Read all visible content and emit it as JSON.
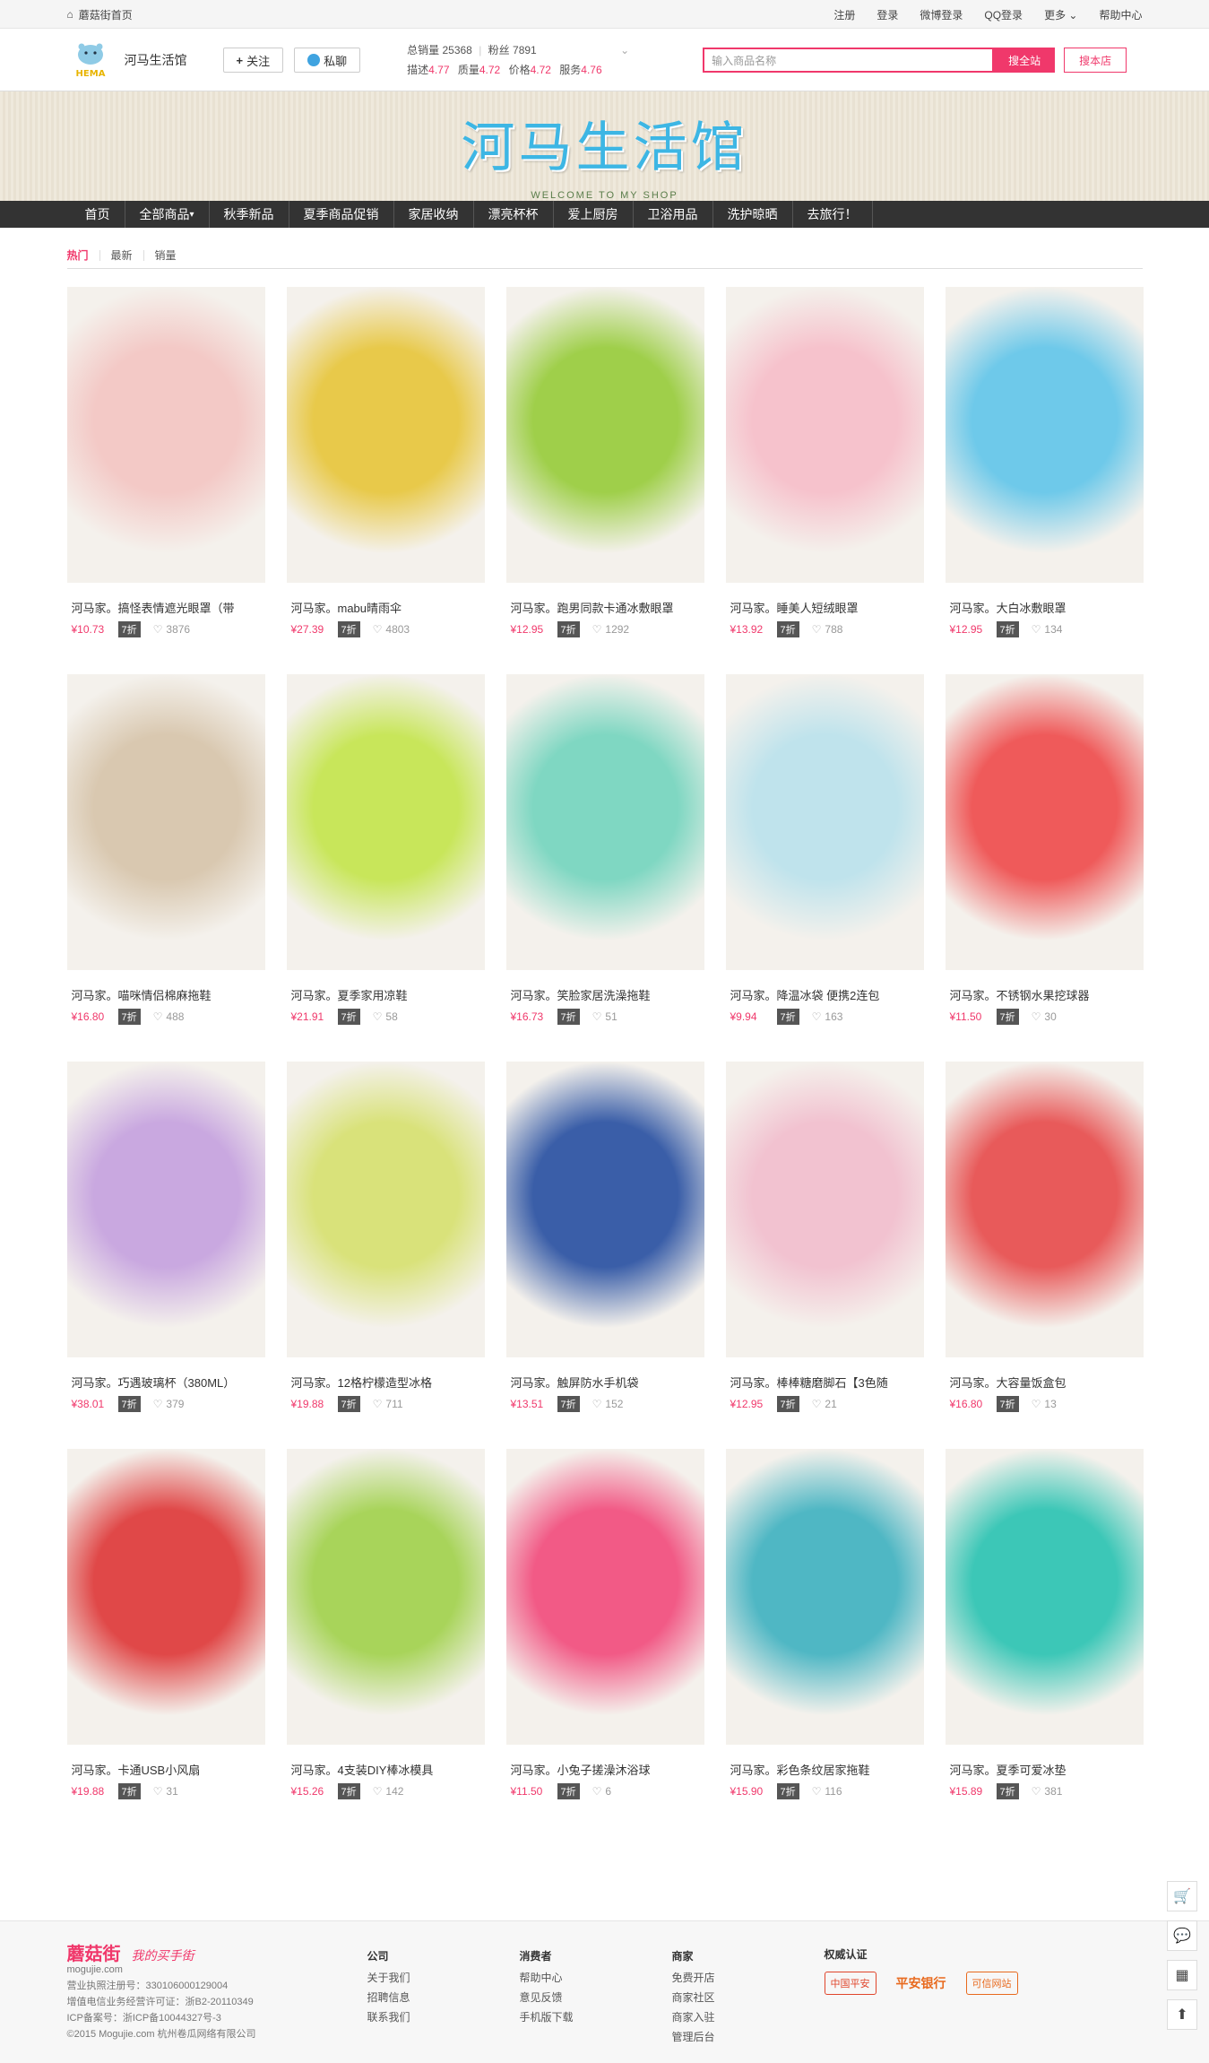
{
  "topbar": {
    "home_label": "蘑菇街首页",
    "register": "注册",
    "login": "登录",
    "weibo_login": "微博登录",
    "qq_login": "QQ登录",
    "more": "更多",
    "help": "帮助中心"
  },
  "shop": {
    "logo_text": "HEMA",
    "name": "河马生活馆",
    "follow_label": "关注",
    "chat_label": "私聊",
    "total_sales_label": "总销量",
    "total_sales": "25368",
    "fans_label": "粉丝",
    "fans": "7891",
    "desc_label": "描述",
    "desc": "4.77",
    "quality_label": "质量",
    "quality": "4.72",
    "price_label": "价格",
    "price": "4.72",
    "service_label": "服务",
    "service": "4.76"
  },
  "search": {
    "placeholder": "输入商品名称",
    "search_all": "搜全站",
    "search_shop": "搜本店"
  },
  "banner": {
    "title": "河马生活馆",
    "subtitle": "WELCOME TO MY SHOP"
  },
  "nav": [
    "首页",
    "全部商品",
    "秋季新品",
    "夏季商品促销",
    "家居收纳",
    "漂亮杯杯",
    "爱上厨房",
    "卫浴用品",
    "洗护晾晒",
    "去旅行！"
  ],
  "tabs": [
    "热门",
    "最新",
    "销量"
  ],
  "products": [
    {
      "name": "河马家。搞怪表情遮光眼罩（带",
      "price": "¥10.73",
      "discount": "7折",
      "favs": "3876",
      "color": "#f3c9c6"
    },
    {
      "name": "河马家。mabu晴雨伞",
      "price": "¥27.39",
      "discount": "7折",
      "favs": "4803",
      "color": "#e8c94a"
    },
    {
      "name": "河马家。跑男同款卡通冰敷眼罩",
      "price": "¥12.95",
      "discount": "7折",
      "favs": "1292",
      "color": "#9fcf4a"
    },
    {
      "name": "河马家。睡美人短绒眼罩",
      "price": "¥13.92",
      "discount": "7折",
      "favs": "788",
      "color": "#f6c2cc"
    },
    {
      "name": "河马家。大白冰敷眼罩",
      "price": "¥12.95",
      "discount": "7折",
      "favs": "134",
      "color": "#6ec9ea"
    },
    {
      "name": "河马家。喵咪情侣棉麻拖鞋",
      "price": "¥16.80",
      "discount": "7折",
      "favs": "488",
      "color": "#d9c8b0"
    },
    {
      "name": "河马家。夏季家用凉鞋",
      "price": "¥21.91",
      "discount": "7折",
      "favs": "58",
      "color": "#c8e65a"
    },
    {
      "name": "河马家。笑脸家居洗澡拖鞋",
      "price": "¥16.73",
      "discount": "7折",
      "favs": "51",
      "color": "#7fd7c2"
    },
    {
      "name": "河马家。降温冰袋 便携2连包",
      "price": "¥9.94",
      "discount": "7折",
      "favs": "163",
      "color": "#bfe3ec"
    },
    {
      "name": "河马家。不锈钢水果挖球器",
      "price": "¥11.50",
      "discount": "7折",
      "favs": "30",
      "color": "#ef5a5a"
    },
    {
      "name": "河马家。巧遇玻璃杯（380ML）",
      "price": "¥38.01",
      "discount": "7折",
      "favs": "379",
      "color": "#c9a8e0"
    },
    {
      "name": "河马家。12格柠檬造型冰格",
      "price": "¥19.88",
      "discount": "7折",
      "favs": "711",
      "color": "#d9e27a"
    },
    {
      "name": "河马家。触屏防水手机袋",
      "price": "¥13.51",
      "discount": "7折",
      "favs": "152",
      "color": "#3a5ea8"
    },
    {
      "name": "河马家。棒棒糖磨脚石【3色随",
      "price": "¥12.95",
      "discount": "7折",
      "favs": "21",
      "color": "#f2c2d0"
    },
    {
      "name": "河马家。大容量饭盒包",
      "price": "¥16.80",
      "discount": "7折",
      "favs": "13",
      "color": "#e85a5a"
    },
    {
      "name": "河马家。卡通USB小风扇",
      "price": "¥19.88",
      "discount": "7折",
      "favs": "31",
      "color": "#e04848"
    },
    {
      "name": "河马家。4支装DIY棒冰模具",
      "price": "¥15.26",
      "discount": "7折",
      "favs": "142",
      "color": "#a8d45a"
    },
    {
      "name": "河马家。小兔子搓澡沐浴球",
      "price": "¥11.50",
      "discount": "7折",
      "favs": "6",
      "color": "#f25a86"
    },
    {
      "name": "河马家。彩色条纹居家拖鞋",
      "price": "¥15.90",
      "discount": "7折",
      "favs": "116",
      "color": "#4fb7c4"
    },
    {
      "name": "河马家。夏季可爱冰垫",
      "price": "¥15.89",
      "discount": "7折",
      "favs": "381",
      "color": "#3cc7b7"
    }
  ],
  "footer": {
    "brand": "蘑菇街",
    "brand_url": "mogujie.com",
    "slogan": "我的买手街",
    "license": "营业执照注册号：330106000129004",
    "icp_license": "增值电信业务经营许可证：浙B2-20110349",
    "icp": "ICP备案号：浙ICP备10044327号-3",
    "copyright": "©2015 Mogujie.com 杭州卷瓜网络有限公司",
    "company": {
      "title": "公司",
      "links": [
        "关于我们",
        "招聘信息",
        "联系我们"
      ]
    },
    "consumer": {
      "title": "消费者",
      "links": [
        "帮助中心",
        "意见反馈",
        "手机版下载"
      ]
    },
    "merchant": {
      "title": "商家",
      "links": [
        "免费开店",
        "商家社区",
        "商家入驻",
        "管理后台"
      ]
    },
    "cert": {
      "title": "权威认证",
      "badge1": "中国平安",
      "badge2": "平安银行",
      "badge3": "可信网站"
    }
  },
  "colors": {
    "accent": "#f0386b",
    "nav_bg": "#333333",
    "banner_title": "#3db6e4"
  }
}
